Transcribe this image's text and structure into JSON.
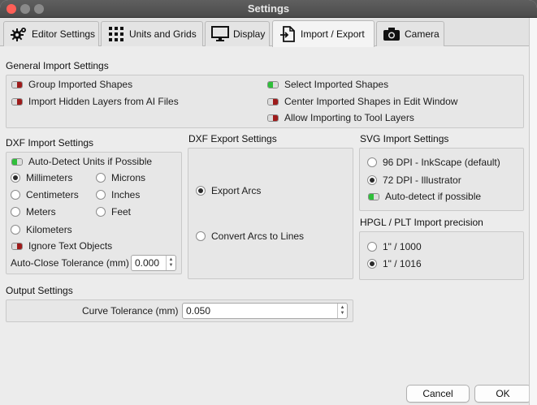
{
  "window": {
    "title": "Settings"
  },
  "tabs": [
    {
      "label": "Editor Settings",
      "icon": "gear-icon"
    },
    {
      "label": "Units and Grids",
      "icon": "grid-icon"
    },
    {
      "label": "Display",
      "icon": "monitor-icon"
    },
    {
      "label": "Import / Export",
      "icon": "import-export-icon",
      "active": true
    },
    {
      "label": "Camera",
      "icon": "camera-icon"
    }
  ],
  "general": {
    "title": "General Import Settings",
    "group_imported_shapes": {
      "label": "Group Imported Shapes",
      "state": "off"
    },
    "import_hidden_layers": {
      "label": "Import Hidden Layers from AI Files",
      "state": "off"
    },
    "select_imported_shapes": {
      "label": "Select Imported Shapes",
      "state": "on"
    },
    "center_imported_shapes": {
      "label": "Center Imported Shapes in Edit Window",
      "state": "off"
    },
    "allow_tool_layers": {
      "label": "Allow Importing to Tool Layers",
      "state": "off"
    }
  },
  "dxf_import": {
    "title": "DXF Import Settings",
    "auto_detect": {
      "label": "Auto-Detect Units if Possible",
      "state": "on"
    },
    "units": [
      "Millimeters",
      "Microns",
      "Centimeters",
      "Inches",
      "Meters",
      "Feet",
      "Kilometers"
    ],
    "selected_unit": "Millimeters",
    "ignore_text": {
      "label": "Ignore Text Objects",
      "state": "off"
    },
    "auto_close": {
      "label": "Auto-Close Tolerance (mm)",
      "value": "0.000"
    }
  },
  "dxf_export": {
    "title": "DXF Export Settings",
    "options": [
      "Export Arcs",
      "Convert Arcs to Lines"
    ],
    "selected": "Export Arcs"
  },
  "svg_import": {
    "title": "SVG Import Settings",
    "options": [
      "96 DPI - InkScape (default)",
      "72 DPI - Illustrator"
    ],
    "selected": "72 DPI - Illustrator",
    "auto_detect": {
      "label": "Auto-detect if possible",
      "state": "on"
    }
  },
  "hpgl": {
    "title": "HPGL / PLT Import precision",
    "options": [
      "1\" / 1000",
      "1\" / 1016"
    ],
    "selected": "1\" / 1016"
  },
  "output": {
    "title": "Output Settings",
    "curve_tolerance": {
      "label": "Curve Tolerance (mm)",
      "value": "0.050"
    }
  },
  "buttons": {
    "cancel": "Cancel",
    "ok": "OK"
  },
  "colors": {
    "toggle_on": "#2fbf3a",
    "toggle_off": "#9e1b1b",
    "close_light": "#ff5f57"
  }
}
